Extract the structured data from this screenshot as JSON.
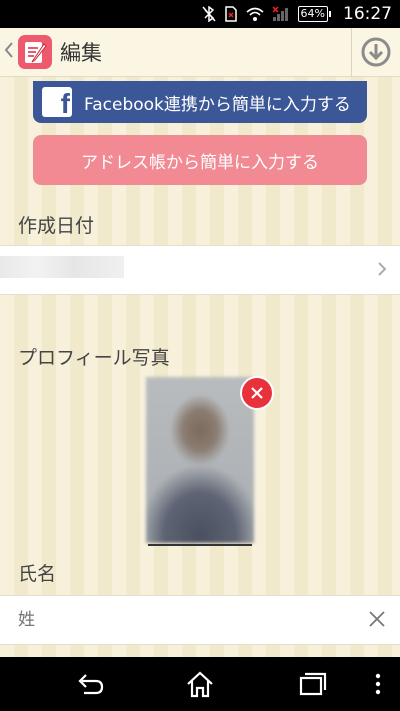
{
  "status_bar": {
    "battery": "64%",
    "time": "16:27"
  },
  "header": {
    "title": "編集",
    "back_icon": "chevron-left-icon",
    "app_icon": "memo-pen-icon",
    "save_icon": "download-circle-icon"
  },
  "import": {
    "facebook_label": "Facebook連携から簡単に入力する",
    "address_book_label": "アドレス帳から簡単に入力する"
  },
  "form": {
    "created_date_label": "作成日付",
    "profile_photo_label": "プロフィール写真",
    "name_label": "氏名",
    "last_name_placeholder": "姓"
  },
  "colors": {
    "facebook_blue": "#3b5797",
    "address_pink": "#f18a93",
    "delete_red": "#e8313b",
    "background": "#f6f0d9"
  }
}
